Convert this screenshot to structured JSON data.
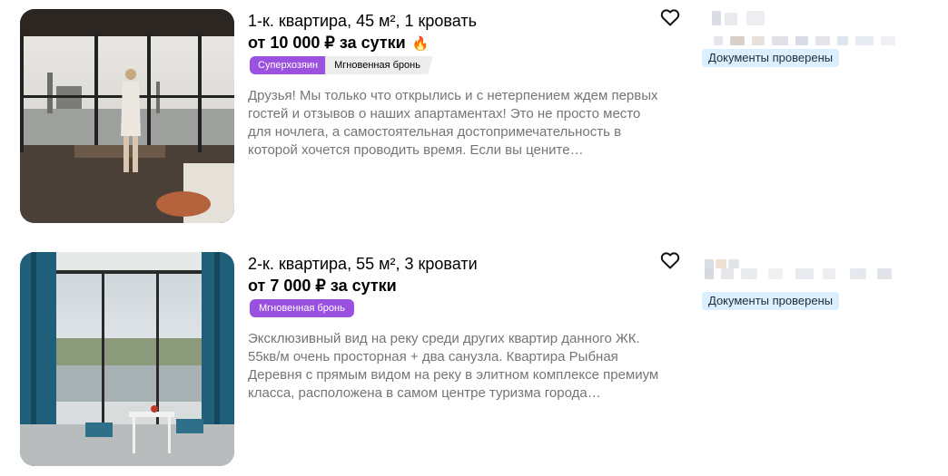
{
  "listings": [
    {
      "title": "1-к. квартира, 45 м², 1 кровать",
      "price": "от 10 000 ₽ за сутки",
      "price_icon": "fire-icon",
      "badges": [
        "Суперхозяин",
        "Мгновенная бронь"
      ],
      "description": "Друзья! Мы только что открылись и с нетерпением ждем первых гостей и отзывов о наших апартаментах! Это не просто место для ночлега, а самостоятельная достопримечательность в которой хочется проводить время. Если вы цените…",
      "seller_badge": "Документы проверены",
      "favorite_icon": "heart-outline-icon"
    },
    {
      "title": "2-к. квартира, 55 м², 3 кровати",
      "price": "от 7 000 ₽ за сутки",
      "badges": [
        "Мгновенная бронь"
      ],
      "description": "Эксклюзивный вид на реку среди других квартир данного ЖК. 55кв/м очень просторная + два санузла. Квартира Рыбная Деревня с прямым видом на реку в элитном комплексе премиум класса, расположена в самом центре туризма города…",
      "seller_badge": "Документы проверены",
      "favorite_icon": "heart-outline-icon"
    }
  ],
  "colors": {
    "badge_purple": "#9b51e0",
    "badge_gray": "#ededed",
    "docs_badge_bg": "#dcefff",
    "description_text": "#757575"
  }
}
